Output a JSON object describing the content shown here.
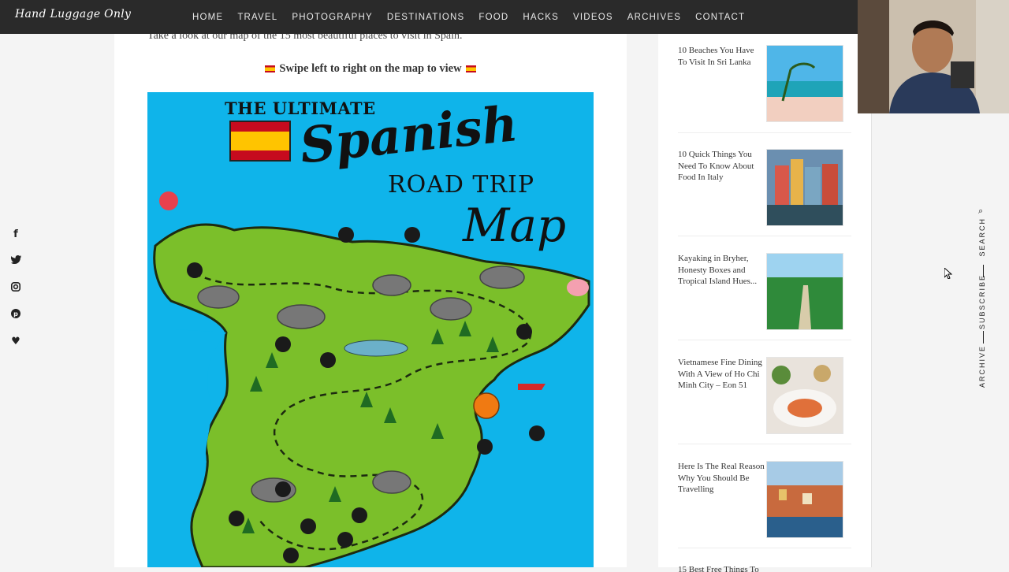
{
  "site": {
    "logo": "Hand Luggage Only",
    "nav": [
      "HOME",
      "TRAVEL",
      "PHOTOGRAPHY",
      "DESTINATIONS",
      "FOOD",
      "HACKS",
      "VIDEOS",
      "ARCHIVES",
      "CONTACT"
    ]
  },
  "article": {
    "intro": "Take a look at our map of the 15 most beautiful places to visit in Spain.",
    "swipe_hint": "Swipe left to right on the map to view",
    "map": {
      "line1": "THE ULTIMATE",
      "line2": "Spanish",
      "line3": "ROAD TRIP",
      "line4": "Map"
    }
  },
  "social": [
    "facebook-icon",
    "twitter-icon",
    "instagram-icon",
    "pinterest-icon",
    "heart-icon"
  ],
  "sidebar": {
    "posts": [
      {
        "title": "10 Beaches You Have To Visit In Sri Lanka",
        "thumb": "beach"
      },
      {
        "title": "10 Quick Things You Need To Know About Food In Italy",
        "thumb": "italy-coast"
      },
      {
        "title": "Kayaking in Bryher, Honesty Boxes and Tropical Island Hues...",
        "thumb": "path"
      },
      {
        "title": "Vietnamese Fine Dining With A View of Ho Chi Minh City – Eon 51",
        "thumb": "food"
      },
      {
        "title": "Here Is The Real Reason Why You Should Be Travelling",
        "thumb": "cinque-terre"
      },
      {
        "title": "15 Best Free Things To",
        "thumb": "partial"
      }
    ]
  },
  "right_menu": {
    "search": "SEARCH",
    "subscribe": "SUBSCRIBE",
    "archive": "ARCHIVE"
  },
  "colors": {
    "topbar": "#2a2a2a",
    "map_sea": "#0fb4ea",
    "map_land": "#7bbf2a",
    "flag_red": "#c60b1e",
    "flag_yellow": "#ffc400"
  }
}
